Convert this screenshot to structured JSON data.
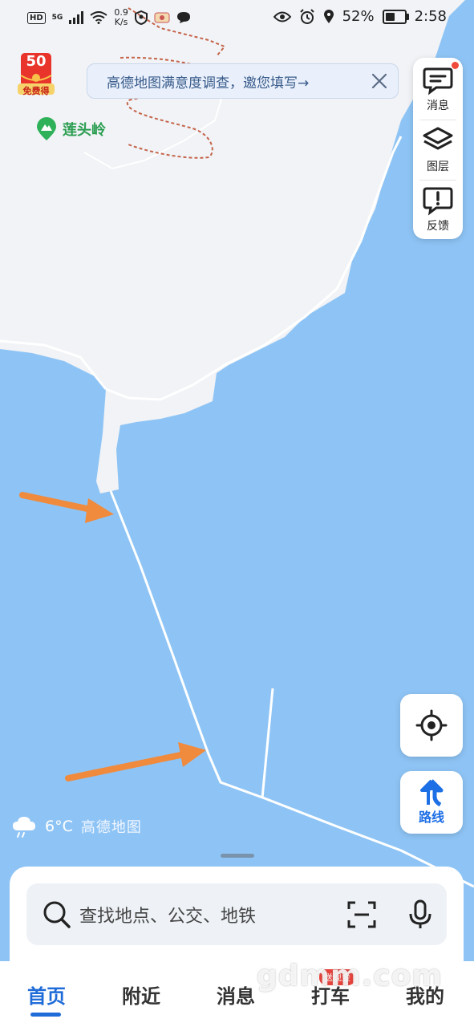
{
  "status_bar": {
    "hd": "HD",
    "net_type": "5G",
    "speed_value": "0.9",
    "speed_unit": "K/s",
    "battery": "52%",
    "time": "2:58"
  },
  "coupon": {
    "amount": "50",
    "label": "免费得"
  },
  "banner": {
    "text": "高德地图满意度调查，邀您填写→"
  },
  "map": {
    "place_label": "莲头岭"
  },
  "tools": {
    "messages": "消息",
    "layers": "图层",
    "feedback": "反馈"
  },
  "route_button": {
    "label": "路线"
  },
  "weather": {
    "temp": "6°C",
    "brand": "高德地图"
  },
  "search": {
    "placeholder": "查找地点、公交、地铁"
  },
  "tabs": [
    {
      "label": "首页",
      "active": true
    },
    {
      "label": "附近",
      "active": false
    },
    {
      "label": "消息",
      "active": false
    },
    {
      "label": "打车",
      "active": false
    },
    {
      "label": "我的",
      "active": false
    }
  ],
  "tab_badge": "送现金",
  "watermark": "gdmm.com",
  "colors": {
    "water": "#8ec4f5",
    "land": "#f1f3f6",
    "accent": "#1f6bd8",
    "arrow": "#f08a3c",
    "place": "#2a9d50"
  }
}
